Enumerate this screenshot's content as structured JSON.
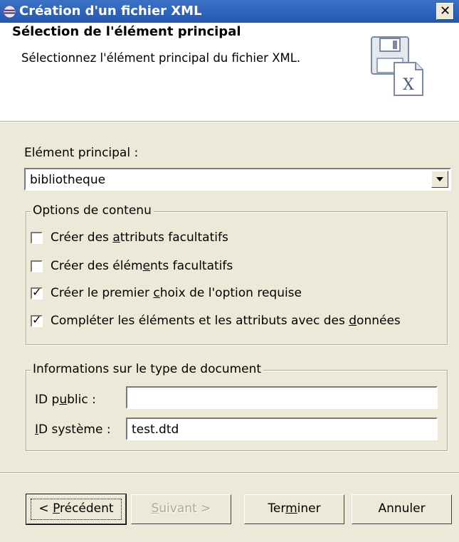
{
  "window": {
    "title": "Création d'un fichier XML",
    "close_label": "✕"
  },
  "header": {
    "title": "Sélection de l'élément principal",
    "description": "Sélectionnez l'élément principal du fichier XML."
  },
  "main_element": {
    "label": "Elément principal :",
    "value": "bibliotheque"
  },
  "content_options": {
    "legend": "Options de contenu",
    "items": [
      {
        "pre": "Créer des ",
        "mn": "a",
        "post": "ttributs facultatifs",
        "checked": false
      },
      {
        "pre": "Créer des élém",
        "mn": "e",
        "post": "nts facultatifs",
        "checked": false
      },
      {
        "pre": "Créer le premier ",
        "mn": "c",
        "post": "hoix de l'option requise",
        "checked": true
      },
      {
        "pre": "Compléter les éléments et les attributs avec des ",
        "mn": "d",
        "post": "onnées",
        "checked": true
      }
    ]
  },
  "doc_type": {
    "legend": "Informations sur le type de document",
    "public_id": {
      "pre": "ID p",
      "mn": "u",
      "post": "blic :",
      "value": ""
    },
    "system_id": {
      "pre": "",
      "mn": "I",
      "post": "D système :",
      "value": "test.dtd"
    }
  },
  "buttons": {
    "back": {
      "pre": "< ",
      "mn": "P",
      "post": "récédent"
    },
    "next": {
      "pre": "",
      "mn": "S",
      "post": "uivant >"
    },
    "finish": {
      "pre": "Ter",
      "mn": "m",
      "post": "iner"
    },
    "cancel": {
      "label": "Annuler"
    }
  }
}
